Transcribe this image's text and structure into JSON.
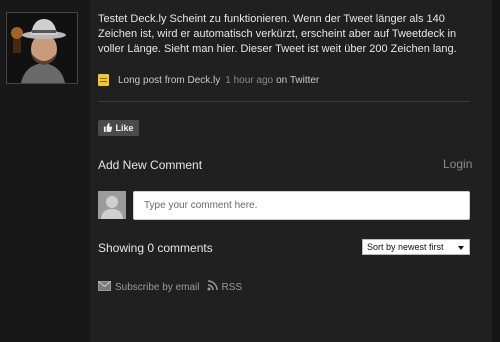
{
  "post": {
    "text": "Testet Deck.ly Scheint zu funktionieren. Wenn der Tweet länger als 140 Zeichen ist, wird er automatisch verkürzt, erscheint aber auf Tweetdeck in voller Länge. Sieht man hier. Dieser Tweet ist weit über 200 Zeichen lang.",
    "source_label": "Long post from Deck.ly",
    "time_label": "1 hour ago",
    "via_label": "on Twitter",
    "source_icon": "note-icon"
  },
  "like": {
    "label": "Like",
    "icon": "thumbs-up-icon"
  },
  "comments": {
    "add_heading": "Add New Comment",
    "login_label": "Login",
    "input_placeholder": "Type your comment here.",
    "count_label": "Showing 0 comments",
    "sort_selected": "Sort by newest first"
  },
  "footer": {
    "subscribe_label": "Subscribe by email",
    "rss_label": "RSS"
  },
  "colors": {
    "background": "#1e1e1e",
    "note_icon": "#f1c72d",
    "muted_text": "#8c8c8c"
  }
}
